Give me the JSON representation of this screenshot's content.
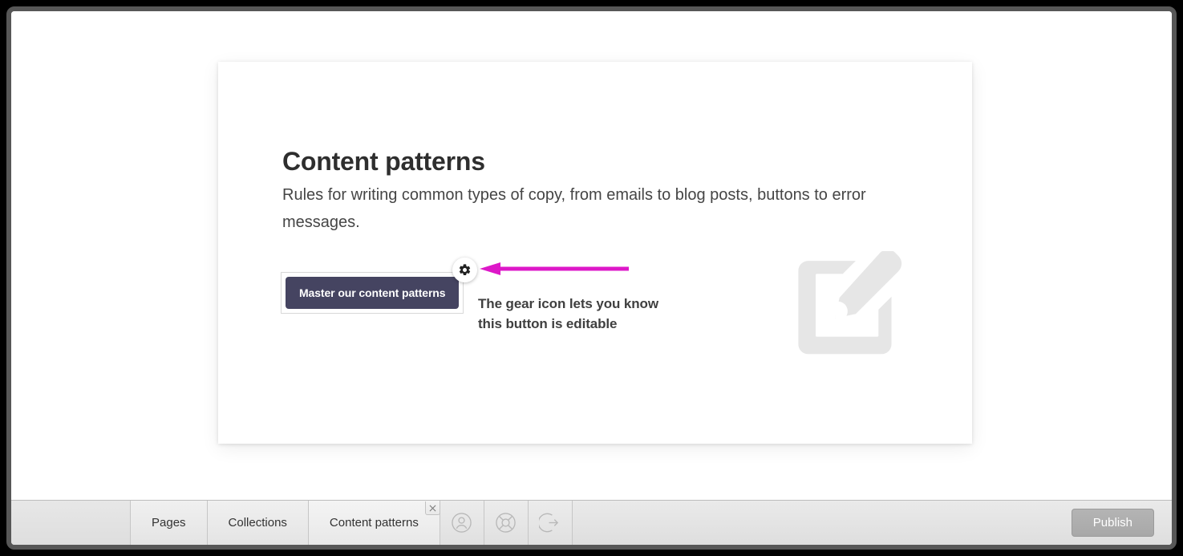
{
  "window": {
    "frame_color": "#575757"
  },
  "card": {
    "title": "Content patterns",
    "description": "Rules for writing common types of copy, from emails to blog posts, buttons to error messages.",
    "cta_label": "Master our content patterns",
    "cta_color": "#454461",
    "gear_icon": "gear-icon",
    "watermark_icon": "edit-pencil-square-icon"
  },
  "annotation": {
    "text": "The gear icon lets you know this button is editable",
    "arrow_color": "#DD18C8",
    "arrow_direction": "left"
  },
  "toolbar": {
    "tabs": [
      {
        "label": "Pages",
        "active": false
      },
      {
        "label": "Collections",
        "active": false
      },
      {
        "label": "Content patterns",
        "active": true
      }
    ],
    "close_label": "×",
    "icons": [
      {
        "name": "account-icon",
        "title": "Account"
      },
      {
        "name": "help-lifebuoy-icon",
        "title": "Help"
      },
      {
        "name": "sign-out-icon",
        "title": "Sign out"
      }
    ],
    "publish_label": "Publish"
  }
}
